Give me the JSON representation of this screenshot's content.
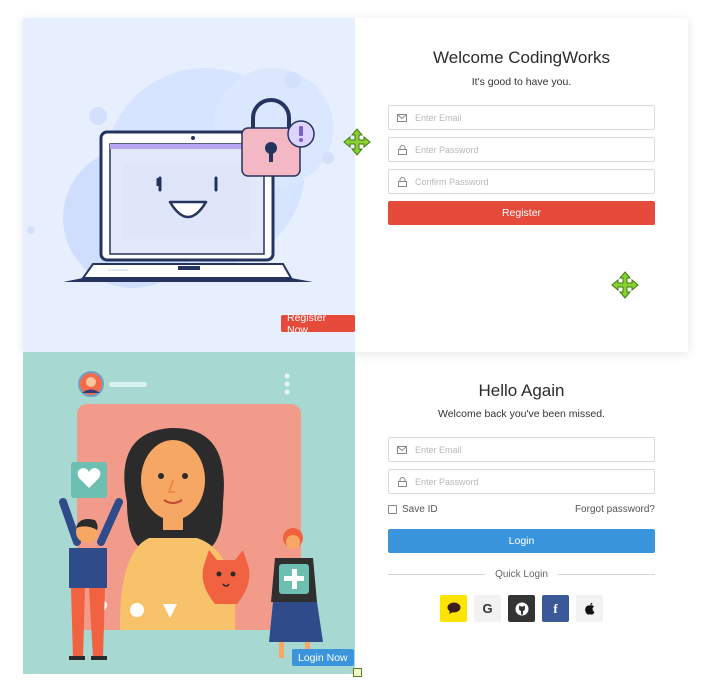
{
  "register": {
    "title": "Welcome CodingWorks",
    "subtitle": "It's good to have you.",
    "email_placeholder": "Enter Email",
    "password_placeholder": "Enter Password",
    "confirm_placeholder": "Confirm Password",
    "button_label": "Register",
    "badge_label": "Register Now"
  },
  "login": {
    "title": "Hello Again",
    "subtitle": "Welcome back you've been missed.",
    "email_placeholder": "Enter Email",
    "password_placeholder": "Enter Password",
    "save_id_label": "Save ID",
    "forgot_label": "Forgot password?",
    "button_label": "Login",
    "quick_login_label": "Quick Login",
    "badge_label": "Login Now",
    "social": [
      {
        "name": "kakao",
        "glyph": "",
        "color": "#fce300"
      },
      {
        "name": "google",
        "glyph": "G",
        "color": "#f2f2f2"
      },
      {
        "name": "github",
        "glyph": "",
        "color": "#333333"
      },
      {
        "name": "facebook",
        "glyph": "f",
        "color": "#3b5998"
      },
      {
        "name": "apple",
        "glyph": "",
        "color": "#f2f2f2"
      }
    ]
  },
  "colors": {
    "register_button": "#e64a3b",
    "login_button": "#3a95dc",
    "register_illustration_bg": "#e7efff",
    "login_illustration_bg": "#a7d8d1"
  }
}
